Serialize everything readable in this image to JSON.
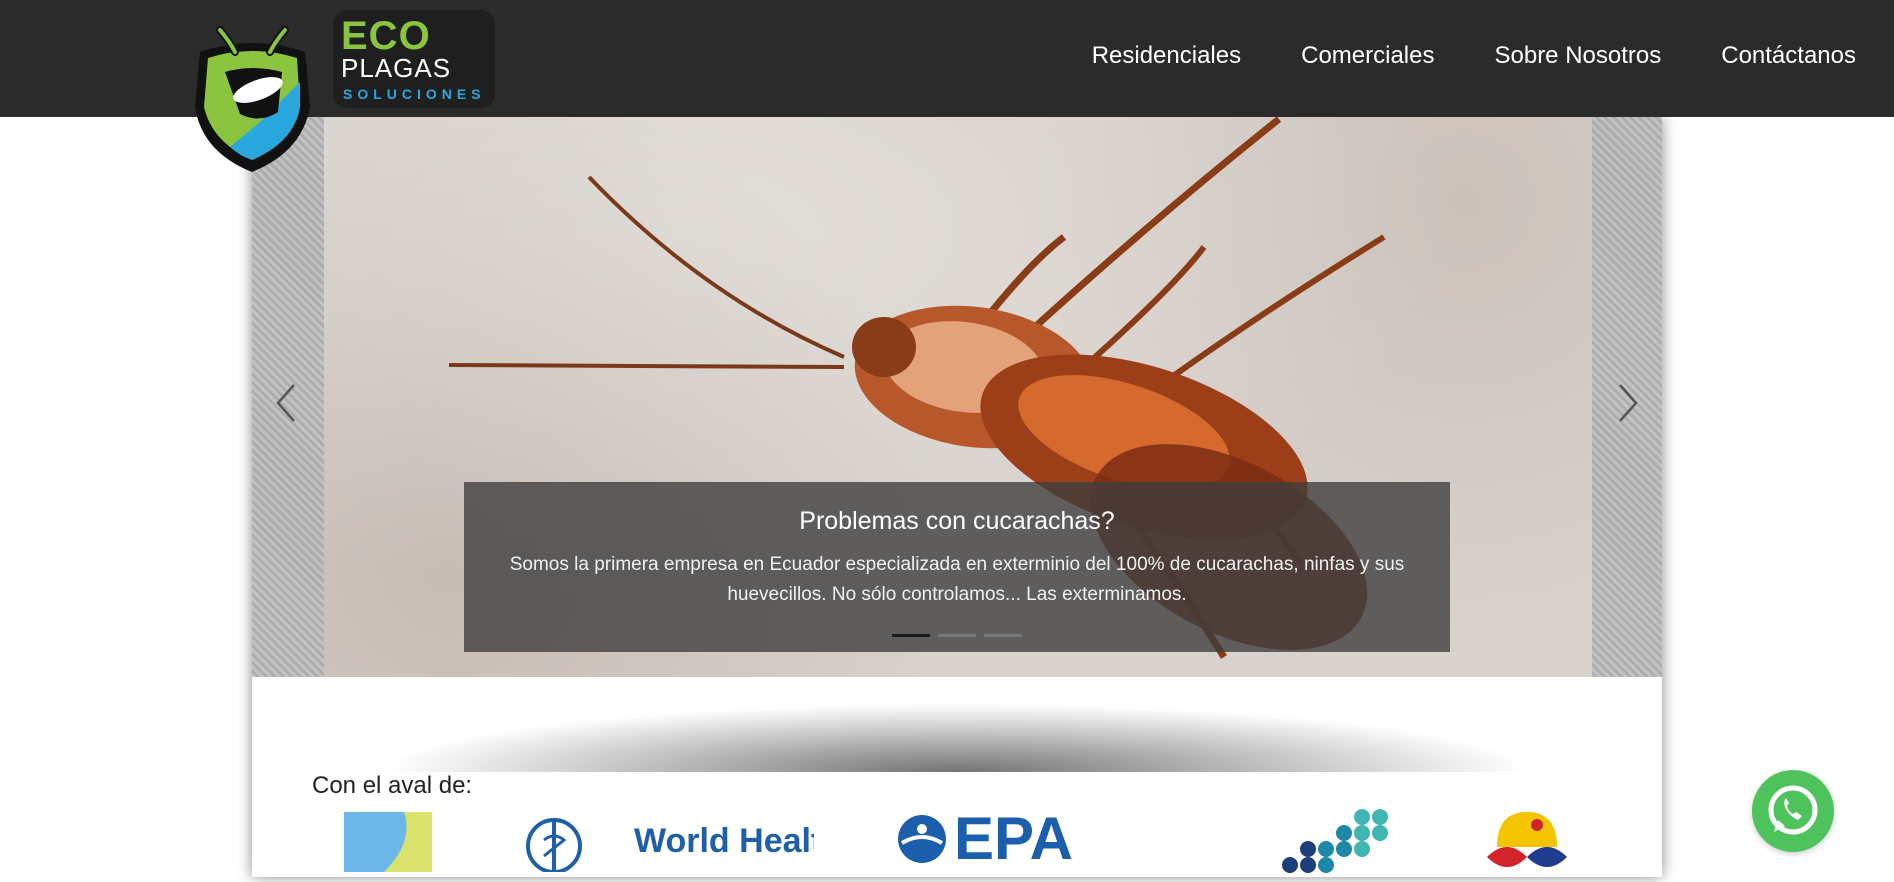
{
  "brand": {
    "eco": "ECO",
    "plagas": "PLAGAS",
    "soluciones": "SOLUCIONES",
    "colors": {
      "green": "#8bc53f",
      "blue": "#29a8e0",
      "header": "#2b2b2b"
    }
  },
  "nav": {
    "items": [
      {
        "label": "Residenciales"
      },
      {
        "label": "Comerciales"
      },
      {
        "label": "Sobre Nosotros"
      },
      {
        "label": "Contáctanos"
      }
    ]
  },
  "carousel": {
    "title": "Problemas con cucarachas?",
    "text": "Somos la primera empresa en Ecuador especializada en exterminio del 100% de cucarachas, ninfas y sus huevecillos. No sólo controlamos... Las exterminamos.",
    "active_index": 0,
    "slide_count": 3,
    "prev_icon": "chevron-left-icon",
    "next_icon": "chevron-right-icon"
  },
  "aval": {
    "label": "Con el aval de:",
    "partners": [
      {
        "name": "partner-logo-1"
      },
      {
        "name": "World Health"
      },
      {
        "name": "EPA"
      },
      {
        "name": "partner-logo-4"
      },
      {
        "name": "partner-logo-5"
      }
    ]
  },
  "whatsapp": {
    "icon": "whatsapp-icon",
    "color": "#4ec35b"
  }
}
